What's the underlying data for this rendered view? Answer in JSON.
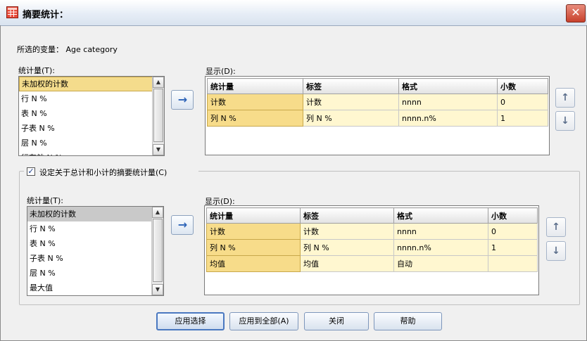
{
  "window": {
    "title": "摘要统计：",
    "close": "✕"
  },
  "selected_variable": "所选的变量： Age category",
  "top": {
    "stats_label": "统计量(T):",
    "stats": [
      "未加权的计数",
      "行 N %",
      "表 N %",
      "子表 N %",
      "层 N %",
      "行有效 N %"
    ],
    "display_label": "显示(D):",
    "columns": [
      "统计量",
      "标签",
      "格式",
      "小数"
    ],
    "rows": [
      [
        "计数",
        "计数",
        "nnnn",
        "0"
      ],
      [
        "列 N %",
        "列 N %",
        "nnnn.n%",
        "1"
      ]
    ]
  },
  "subtotal": {
    "checkbox_label": "设定关于总计和小计的摘要统计量(C)",
    "checked": true,
    "stats_label": "统计量(T):",
    "stats": [
      "未加权的计数",
      "行 N %",
      "表 N %",
      "子表 N %",
      "层 N %",
      "最大值"
    ],
    "display_label": "显示(D):",
    "columns": [
      "统计量",
      "标签",
      "格式",
      "小数"
    ],
    "rows": [
      [
        "计数",
        "计数",
        "nnnn",
        "0"
      ],
      [
        "列 N %",
        "列 N %",
        "nnnn.n%",
        "1"
      ],
      [
        "均值",
        "均值",
        "自动",
        ""
      ]
    ]
  },
  "buttons": {
    "apply": "应用选择",
    "apply_all": "应用到全部(A)",
    "close": "关闭",
    "help": "帮助"
  },
  "icons": {
    "move_right": "→",
    "move_up": "↑",
    "move_down": "↓"
  }
}
